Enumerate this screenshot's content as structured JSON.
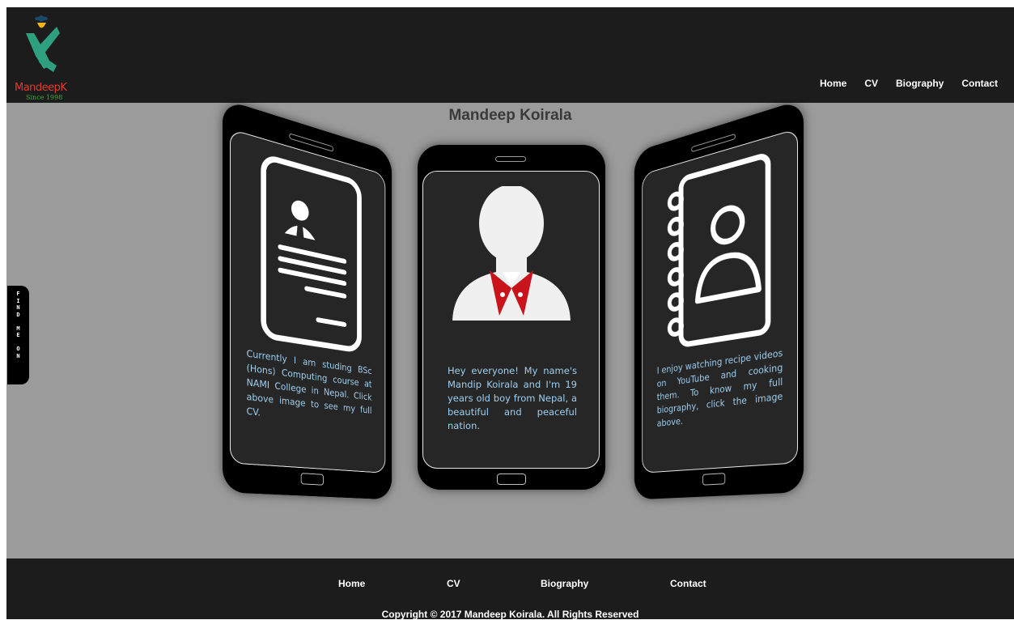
{
  "brand": {
    "name": "MandeepK",
    "since": "Since 1998"
  },
  "nav": {
    "items": [
      "Home",
      "CV",
      "Biography",
      "Contact"
    ]
  },
  "main": {
    "title": "Mandeep Koirala",
    "cards": [
      {
        "icon": "cv-document-icon",
        "text": "Currently I am studing BSc (Hons) Computing course at NAMI College in Nepal. Click above image to see my full CV."
      },
      {
        "icon": "profile-avatar-icon",
        "text": "Hey everyone! My name's Mandip Koirala and I'm 19 years old boy from Nepal, a beautiful and peaceful nation."
      },
      {
        "icon": "contact-book-icon",
        "text": "I enjoy watching recipe videos on YouTube and cooking them. To know my full biography, click the image above."
      }
    ]
  },
  "findme": {
    "label": "FIND ME ON"
  },
  "footer": {
    "nav": [
      "Home",
      "CV",
      "Biography",
      "Contact"
    ],
    "copyright": "Copyright © 2017 Mandeep Koirala. All Rights Reserved"
  },
  "colors": {
    "header_bg": "#1c1c1c",
    "main_bg": "#9b9b9b",
    "accent_red": "#e03a2f",
    "card_text": "#9ecff0"
  }
}
